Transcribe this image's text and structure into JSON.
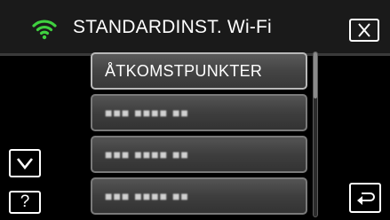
{
  "header": {
    "title": "STANDARDINST. Wi-Fi",
    "wifi_icon": "wifi-icon",
    "close_icon": "close-icon"
  },
  "menu": {
    "items": [
      {
        "label": "ÅTKOMSTPUNKTER",
        "selected": true
      },
      {
        "label": "■■■ ■■■■ ■■",
        "selected": false
      },
      {
        "label": "■■■ ■■■■ ■■",
        "selected": false
      },
      {
        "label": "■■■ ■■■■ ■■",
        "selected": false
      }
    ]
  },
  "controls": {
    "down_icon": "chevron-down-icon",
    "help_label": "?",
    "back_icon": "return-arrow-icon"
  },
  "scrollbar": {
    "visible_fraction": 0.28,
    "position_fraction": 0.0
  },
  "colors": {
    "wifi_accent": "#3fd13f",
    "background": "#000000",
    "text": "#ffffff"
  }
}
